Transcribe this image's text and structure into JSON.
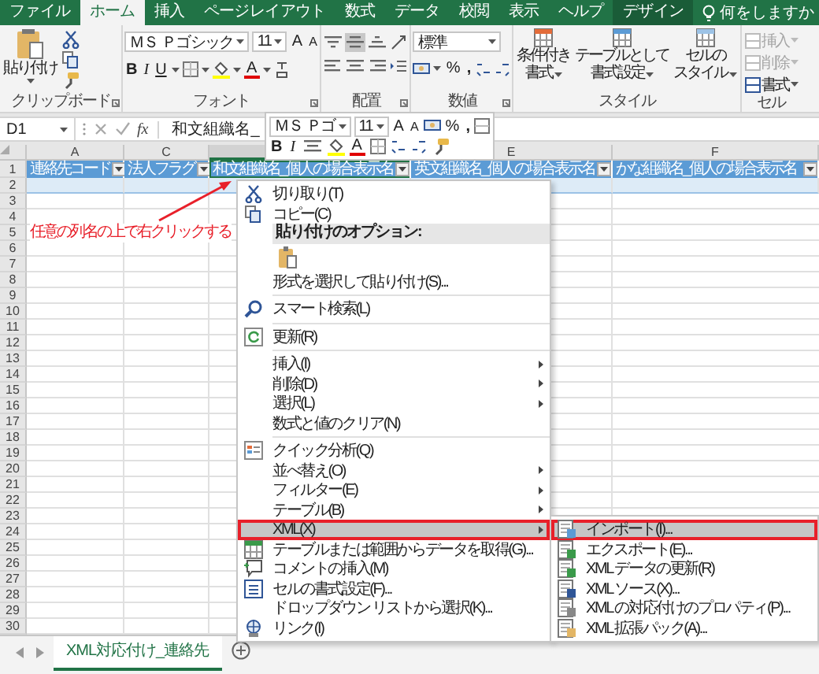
{
  "ribbon_tabs": [
    {
      "label": "ファイル",
      "selected": false,
      "kind": "tab"
    },
    {
      "label": "ホーム",
      "selected": true,
      "kind": "tab"
    },
    {
      "label": "挿入",
      "selected": false,
      "kind": "tab"
    },
    {
      "label": "ページレイアウト",
      "selected": false,
      "kind": "tab"
    },
    {
      "label": "数式",
      "selected": false,
      "kind": "tab"
    },
    {
      "label": "データ",
      "selected": false,
      "kind": "tab"
    },
    {
      "label": "校閲",
      "selected": false,
      "kind": "tab"
    },
    {
      "label": "表示",
      "selected": false,
      "kind": "tab"
    },
    {
      "label": "ヘルプ",
      "selected": false,
      "kind": "tab"
    },
    {
      "label": "デザイン",
      "selected": false,
      "kind": "contextual"
    }
  ],
  "tell_me": {
    "placeholder": "何をしますか"
  },
  "clipboard": {
    "paste_label": "貼り付け",
    "group_label": "クリップボード"
  },
  "font": {
    "name": "ＭＳ Ｐゴシック",
    "size": "11",
    "grow": "A",
    "shrink": "A",
    "bold": "B",
    "italic": "I",
    "underline": "U",
    "font_color": "A",
    "group_label": "フォント"
  },
  "alignment": {
    "group_label": "配置",
    "middle_on": true
  },
  "number": {
    "format": "標準",
    "percent": "%",
    "comma": ",",
    "group_label": "数値"
  },
  "styles": {
    "group_label": "スタイル",
    "buttons": [
      {
        "lines": [
          "条件付き",
          "書式"
        ]
      },
      {
        "lines": [
          "テーブルとして",
          "書式設定"
        ]
      },
      {
        "lines": [
          "セルの",
          "スタイル"
        ]
      }
    ]
  },
  "cells": {
    "group_label": "セル",
    "buttons": [
      {
        "label": "挿入",
        "disabled": true
      },
      {
        "label": "削除",
        "disabled": true
      },
      {
        "label": "書式",
        "disabled": false
      }
    ]
  },
  "formula_bar": {
    "name_box": "D1",
    "function_label": "fx",
    "formula": "和文組織名_"
  },
  "mini_toolbar": {
    "font": "ＭＳ Ｐゴ",
    "size": "11",
    "grow": "A",
    "shrink": "A",
    "percent": "%",
    "comma": ",",
    "bold": "B",
    "italic": "I",
    "font_color": "A"
  },
  "columns": [
    {
      "label": "A",
      "selected": false
    },
    {
      "label": "C",
      "selected": false
    },
    {
      "selected": true
    },
    {
      "label": "E",
      "selected": false
    },
    {
      "label": "F",
      "selected": false
    }
  ],
  "header_row": [
    {
      "text": "連絡先コード",
      "selected": false
    },
    {
      "text": "法人フラグ",
      "selected": false
    },
    {
      "text": "和文組織名_個人の場合表示名",
      "selected": true
    },
    {
      "text": "英文組織名_個人の場合表示名",
      "selected": false
    },
    {
      "text": "かな組織名_個人の場合表示名",
      "selected": false
    }
  ],
  "rows": [
    {
      "number": "1",
      "kind": "header"
    },
    {
      "number": "2",
      "kind": "table"
    },
    {
      "number": "3",
      "kind": "plain"
    },
    {
      "number": "4",
      "kind": "plain"
    },
    {
      "number": "5",
      "kind": "plain"
    },
    {
      "number": "6",
      "kind": "plain"
    },
    {
      "number": "7",
      "kind": "plain"
    },
    {
      "number": "8",
      "kind": "plain"
    },
    {
      "number": "9",
      "kind": "plain"
    },
    {
      "number": "10",
      "kind": "plain"
    },
    {
      "number": "11",
      "kind": "plain"
    },
    {
      "number": "12",
      "kind": "plain"
    },
    {
      "number": "13",
      "kind": "plain"
    },
    {
      "number": "14",
      "kind": "plain"
    },
    {
      "number": "15",
      "kind": "plain"
    },
    {
      "number": "16",
      "kind": "plain"
    },
    {
      "number": "17",
      "kind": "plain"
    },
    {
      "number": "18",
      "kind": "plain"
    },
    {
      "number": "19",
      "kind": "plain"
    },
    {
      "number": "20",
      "kind": "plain"
    },
    {
      "number": "21",
      "kind": "plain"
    },
    {
      "number": "22",
      "kind": "plain"
    },
    {
      "number": "23",
      "kind": "plain"
    },
    {
      "number": "24",
      "kind": "plain"
    },
    {
      "number": "25",
      "kind": "plain"
    },
    {
      "number": "26",
      "kind": "plain"
    },
    {
      "number": "27",
      "kind": "plain"
    },
    {
      "number": "28",
      "kind": "plain"
    },
    {
      "number": "29",
      "kind": "plain"
    },
    {
      "number": "30",
      "kind": "plain"
    }
  ],
  "annotation": {
    "text": "任意の列名の上で右クリックする"
  },
  "context_menu": [
    {
      "kind": "item",
      "label": "切り取り(T)",
      "selected": false,
      "highlighted": false
    },
    {
      "kind": "item",
      "label": "コピー(C)",
      "selected": false,
      "highlighted": false
    },
    {
      "kind": "header",
      "label": "貼り付けのオプション:"
    },
    {
      "kind": "paste_icons"
    },
    {
      "kind": "item",
      "label": "形式を選択して貼り付け(S)...",
      "selected": false,
      "highlighted": false
    },
    {
      "kind": "separator"
    },
    {
      "kind": "item",
      "label": "スマート検索(L)",
      "selected": false,
      "highlighted": false
    },
    {
      "kind": "separator"
    },
    {
      "kind": "item",
      "label": "更新(R)",
      "selected": false,
      "highlighted": false
    },
    {
      "kind": "separator"
    },
    {
      "kind": "item",
      "label": "挿入(I)",
      "selected": false,
      "highlighted": false,
      "submenu": true
    },
    {
      "kind": "item",
      "label": "削除(D)",
      "selected": false,
      "highlighted": false,
      "submenu": true
    },
    {
      "kind": "item",
      "label": "選択(L)",
      "selected": false,
      "highlighted": false,
      "submenu": true
    },
    {
      "kind": "item",
      "label": "数式と値のクリア(N)",
      "selected": false,
      "highlighted": false
    },
    {
      "kind": "separator"
    },
    {
      "kind": "item",
      "label": "クイック分析(Q)",
      "selected": false,
      "highlighted": false
    },
    {
      "kind": "item",
      "label": "並べ替え(O)",
      "selected": false,
      "highlighted": false,
      "submenu": true
    },
    {
      "kind": "item",
      "label": "フィルター(E)",
      "selected": false,
      "highlighted": false,
      "submenu": true
    },
    {
      "kind": "item",
      "label": "テーブル(B)",
      "selected": false,
      "highlighted": false,
      "submenu": true
    },
    {
      "kind": "item",
      "label": "XML(X)",
      "selected": true,
      "highlighted": true,
      "submenu": true,
      "children": [
        {
          "label": "インポート(I)...",
          "selected": true,
          "highlighted": true
        },
        {
          "label": "エクスポート(E)...",
          "selected": false,
          "highlighted": false
        },
        {
          "label": "XML データの更新(R)",
          "selected": false,
          "highlighted": false
        },
        {
          "label": "XML ソース(X)...",
          "selected": false,
          "highlighted": false
        },
        {
          "label": "XML の対応付けのプロパティ(P)...",
          "selected": false,
          "highlighted": false
        },
        {
          "label": "XML 拡張パック(A)...",
          "selected": false,
          "highlighted": false
        }
      ]
    },
    {
      "kind": "item",
      "label": "テーブルまたは範囲からデータを取得(G)...",
      "selected": false,
      "highlighted": false
    },
    {
      "kind": "item",
      "label": "コメントの挿入(M)",
      "selected": false,
      "highlighted": false
    },
    {
      "kind": "item",
      "label": "セルの書式設定(F)...",
      "selected": false,
      "highlighted": false
    },
    {
      "kind": "item",
      "label": "ドロップダウン リストから選択(K)...",
      "selected": false,
      "highlighted": false
    },
    {
      "kind": "item",
      "label": "リンク(I)",
      "selected": false,
      "highlighted": false
    }
  ],
  "sheet_tabs": [
    {
      "label": "XML対応付け_連絡先",
      "selected": true
    }
  ]
}
